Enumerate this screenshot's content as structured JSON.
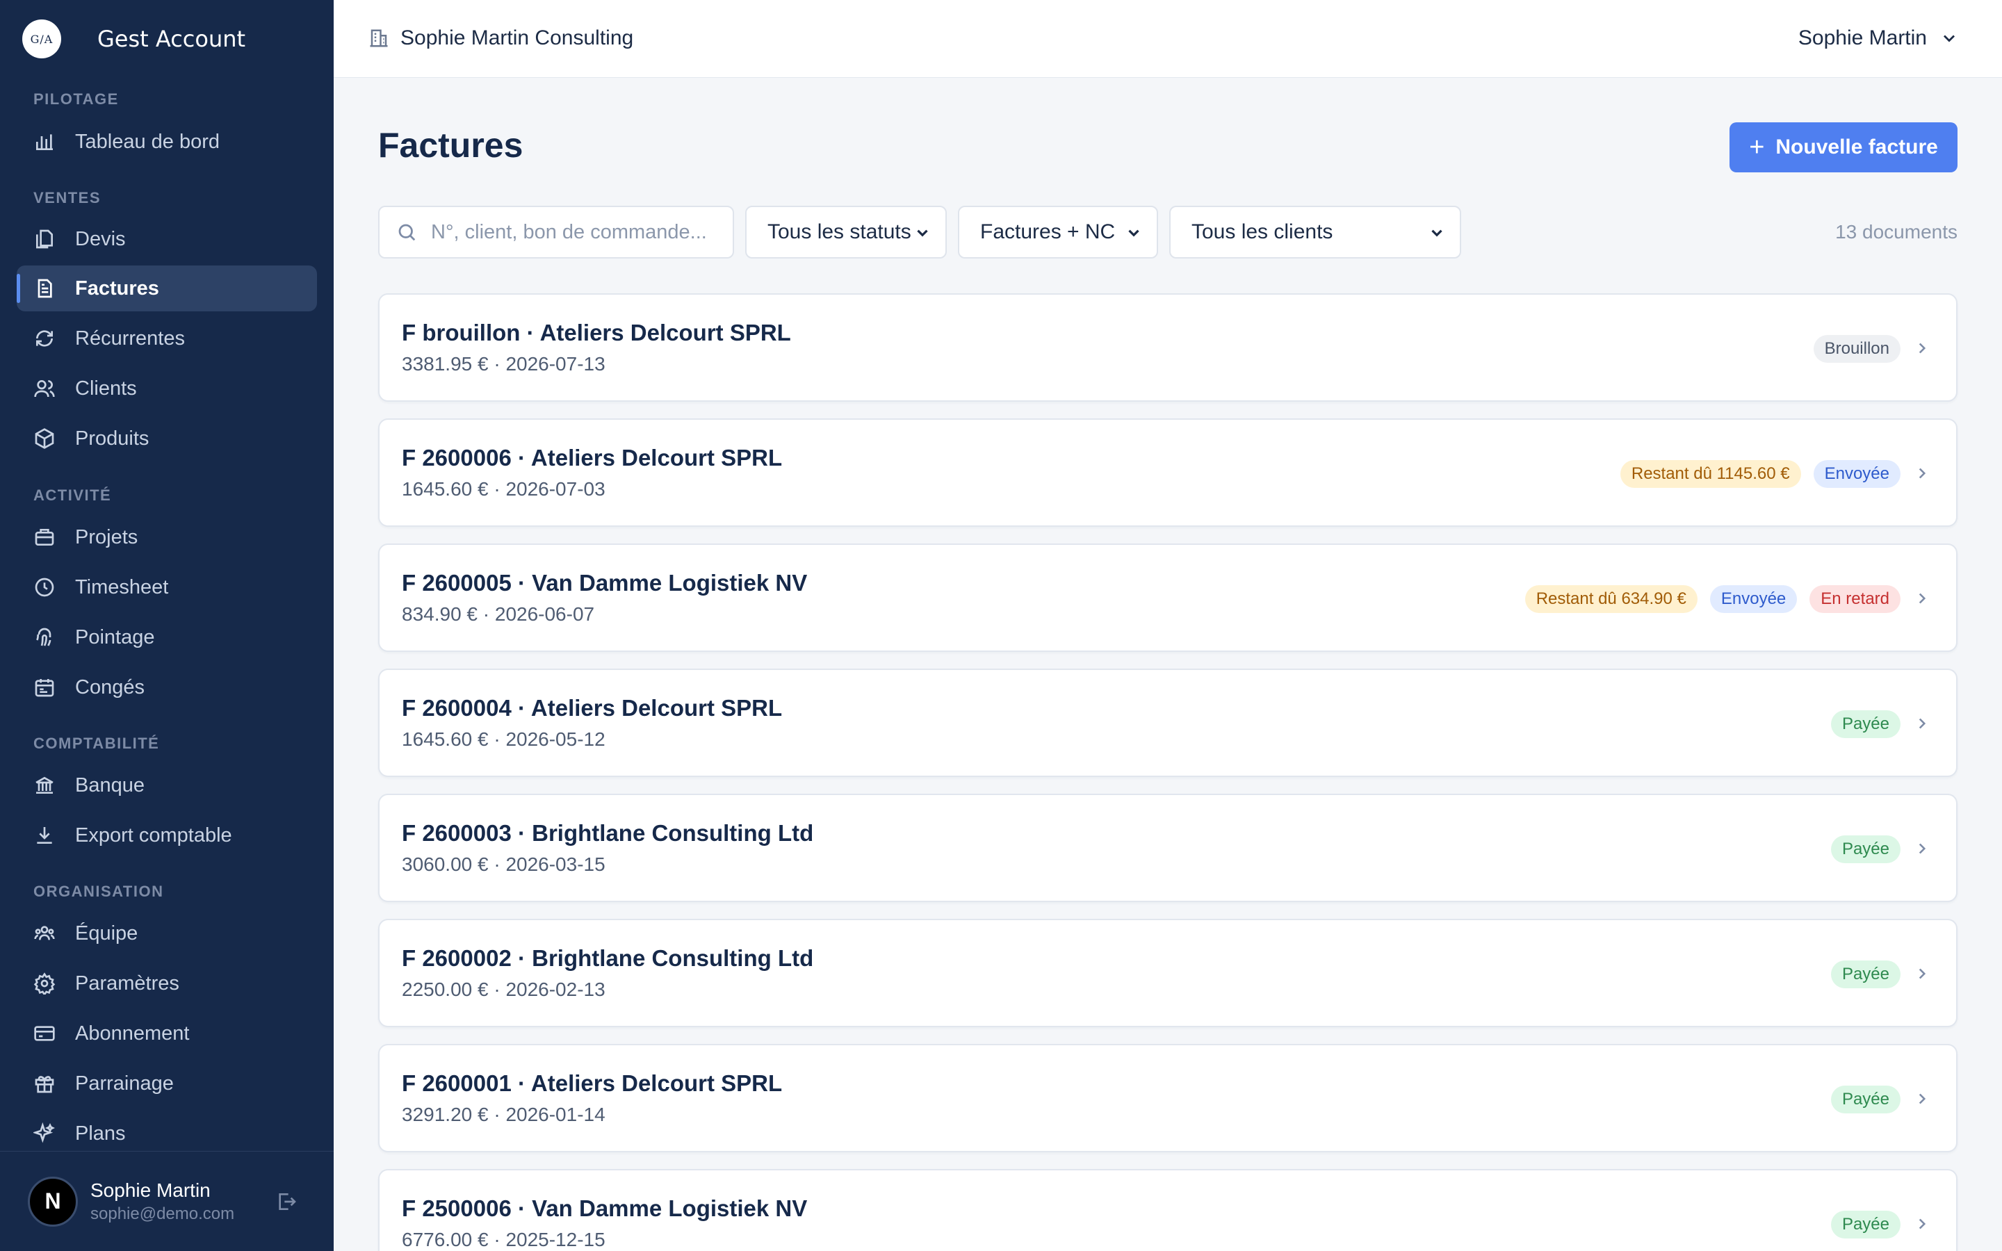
{
  "brand": {
    "logo_text": "G/A",
    "name": "Gest Account"
  },
  "sidebar": {
    "sections": [
      {
        "label": "PILOTAGE"
      },
      {
        "label": "VENTES"
      },
      {
        "label": "ACTIVITÉ"
      },
      {
        "label": "COMPTABILITÉ"
      },
      {
        "label": "ORGANISATION"
      }
    ],
    "items": [
      {
        "label": "Tableau de bord",
        "icon": "bar-chart-icon"
      },
      {
        "label": "Devis",
        "icon": "documents-icon"
      },
      {
        "label": "Factures",
        "icon": "invoice-icon",
        "active": true
      },
      {
        "label": "Récurrentes",
        "icon": "refresh-icon"
      },
      {
        "label": "Clients",
        "icon": "users-icon"
      },
      {
        "label": "Produits",
        "icon": "box-icon"
      },
      {
        "label": "Projets",
        "icon": "briefcase-icon"
      },
      {
        "label": "Timesheet",
        "icon": "clock-icon"
      },
      {
        "label": "Pointage",
        "icon": "fingerprint-icon"
      },
      {
        "label": "Congés",
        "icon": "calendar-icon"
      },
      {
        "label": "Banque",
        "icon": "bank-icon"
      },
      {
        "label": "Export comptable",
        "icon": "download-icon"
      },
      {
        "label": "Équipe",
        "icon": "team-icon"
      },
      {
        "label": "Paramètres",
        "icon": "gear-icon"
      },
      {
        "label": "Abonnement",
        "icon": "credit-card-icon"
      },
      {
        "label": "Parrainage",
        "icon": "gift-icon"
      },
      {
        "label": "Plans",
        "icon": "sparkles-icon"
      }
    ],
    "user": {
      "initial": "N",
      "name": "Sophie Martin",
      "email": "sophie@demo.com"
    }
  },
  "topbar": {
    "org_name": "Sophie Martin Consulting",
    "user_name": "Sophie Martin"
  },
  "main": {
    "title": "Factures",
    "new_button": "Nouvelle facture",
    "search_placeholder": "N°, client, bon de commande...",
    "filters": {
      "status": "Tous les statuts",
      "type": "Factures + NC",
      "client": "Tous les clients"
    },
    "doc_count": "13 documents",
    "invoices": [
      {
        "title": "F brouillon · Ateliers Delcourt SPRL",
        "sub": "3381.95 € · 2026-07-13",
        "badges": [
          {
            "text": "Brouillon",
            "kind": "draft"
          }
        ]
      },
      {
        "title": "F 2600006 · Ateliers Delcourt SPRL",
        "sub": "1645.60 € · 2026-07-03",
        "badges": [
          {
            "text": "Restant dû 1145.60 €",
            "kind": "due"
          },
          {
            "text": "Envoyée",
            "kind": "sent"
          }
        ]
      },
      {
        "title": "F 2600005 · Van Damme Logistiek NV",
        "sub": "834.90 € · 2026-06-07",
        "badges": [
          {
            "text": "Restant dû 634.90 €",
            "kind": "due"
          },
          {
            "text": "Envoyée",
            "kind": "sent"
          },
          {
            "text": "En retard",
            "kind": "late"
          }
        ]
      },
      {
        "title": "F 2600004 · Ateliers Delcourt SPRL",
        "sub": "1645.60 € · 2026-05-12",
        "badges": [
          {
            "text": "Payée",
            "kind": "paid"
          }
        ]
      },
      {
        "title": "F 2600003 · Brightlane Consulting Ltd",
        "sub": "3060.00 € · 2026-03-15",
        "badges": [
          {
            "text": "Payée",
            "kind": "paid"
          }
        ]
      },
      {
        "title": "F 2600002 · Brightlane Consulting Ltd",
        "sub": "2250.00 € · 2026-02-13",
        "badges": [
          {
            "text": "Payée",
            "kind": "paid"
          }
        ]
      },
      {
        "title": "F 2600001 · Ateliers Delcourt SPRL",
        "sub": "3291.20 € · 2026-01-14",
        "badges": [
          {
            "text": "Payée",
            "kind": "paid"
          }
        ]
      },
      {
        "title": "F 2500006 · Van Damme Logistiek NV",
        "sub": "6776.00 € · 2025-12-15",
        "badges": [
          {
            "text": "Payée",
            "kind": "paid"
          }
        ]
      }
    ]
  }
}
